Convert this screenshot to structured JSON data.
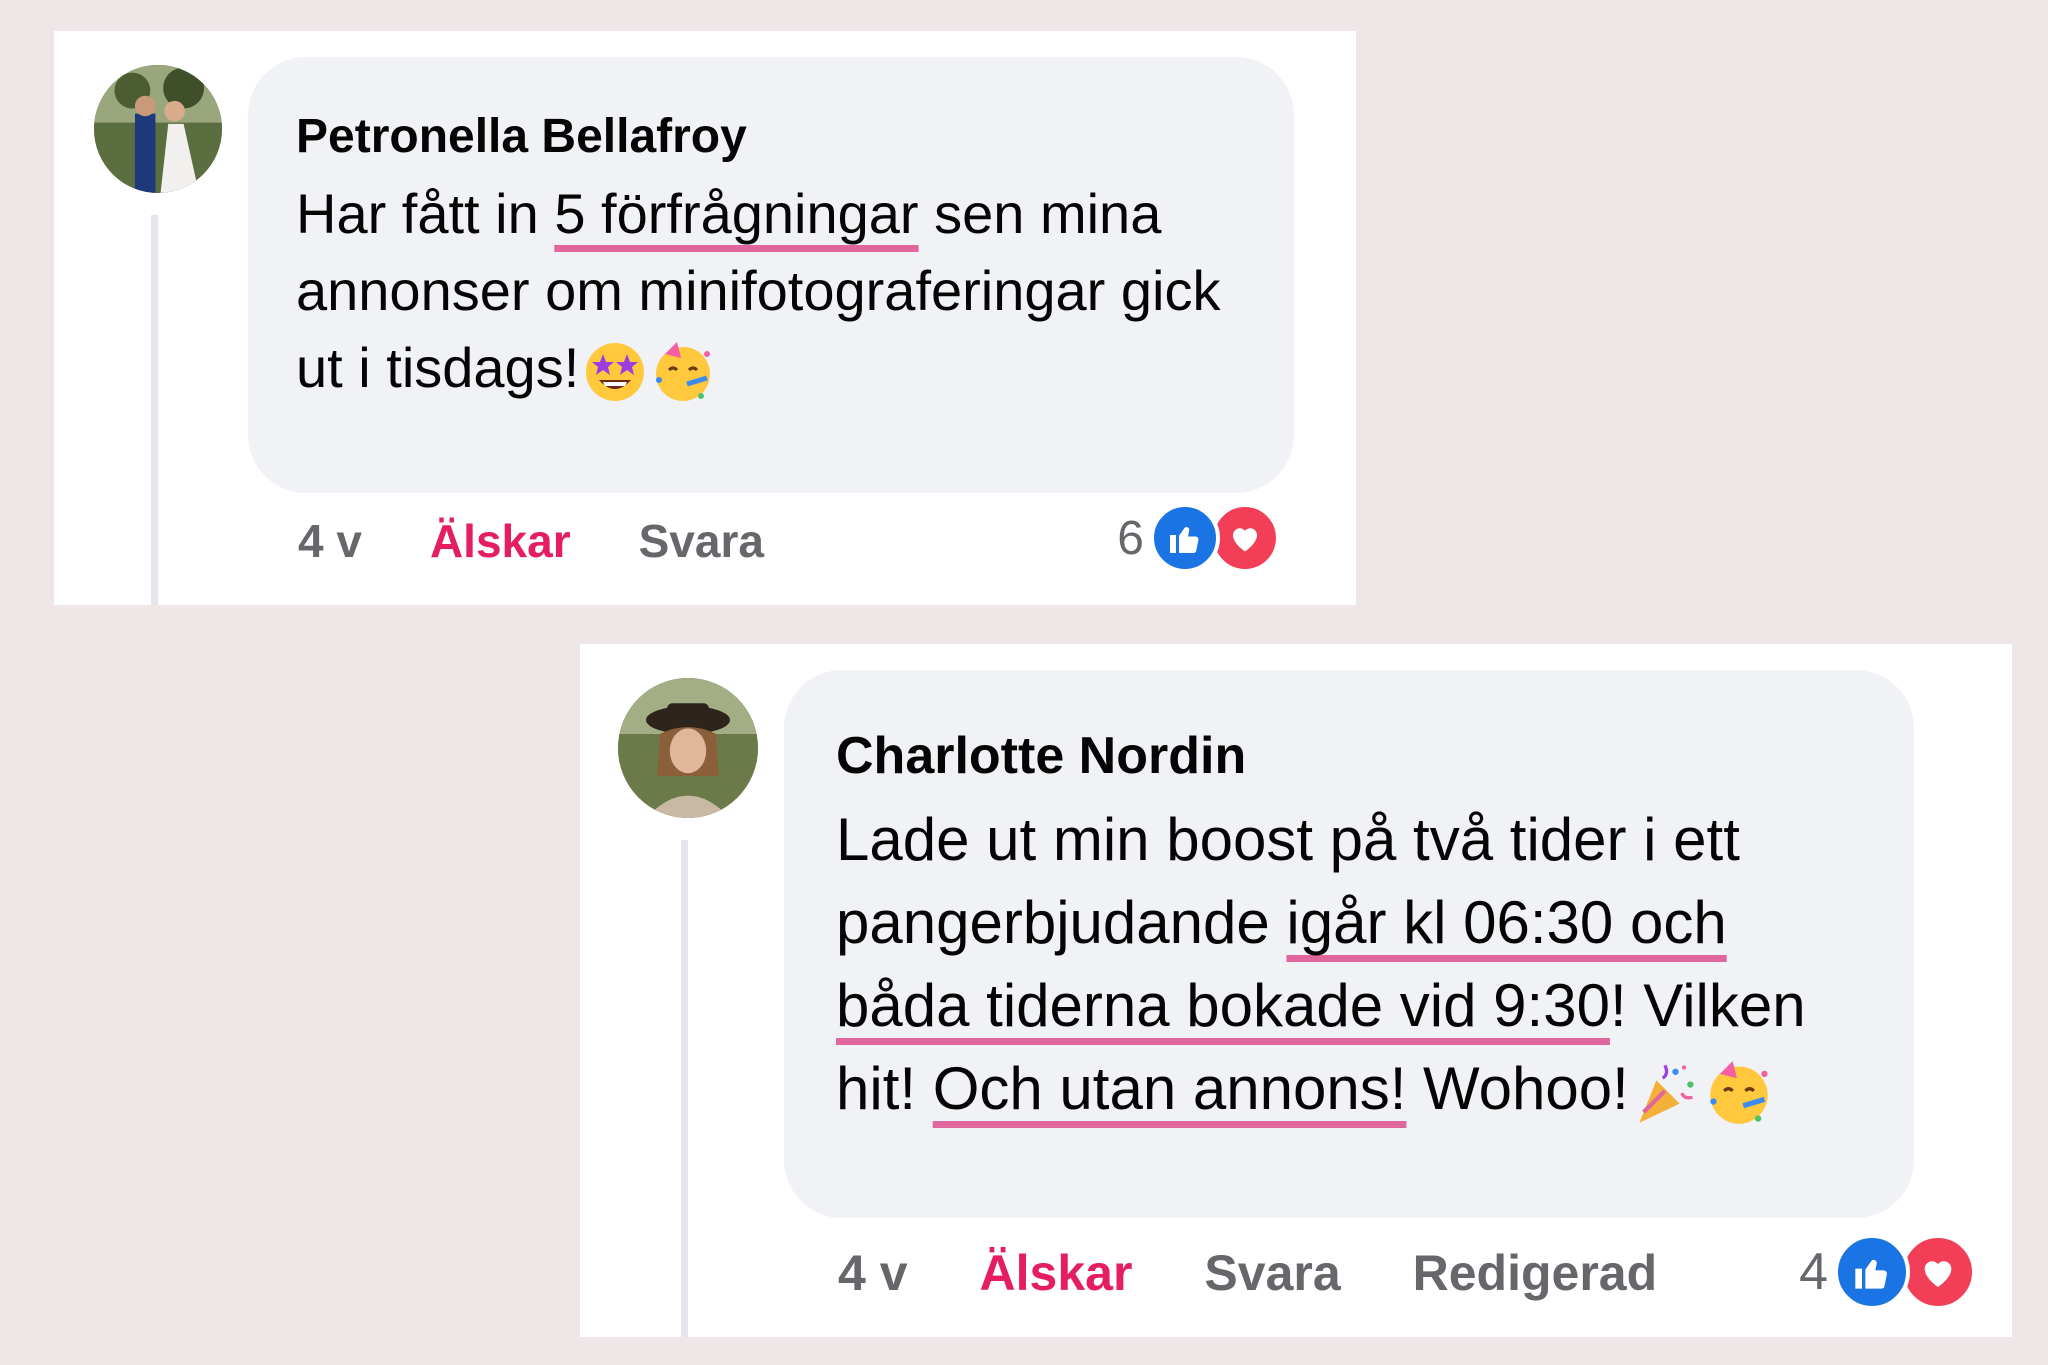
{
  "comments": [
    {
      "author": "Petronella Bellafroy",
      "text_before": "Har fått in ",
      "text_highlight": "5 förfrågningar",
      "text_after": " sen mina annonser om minifotograferingar gick ut i tisdags!",
      "emojis": [
        "star-struck-emoji",
        "partying-face-emoji"
      ],
      "time": "4 v",
      "reaction_label": "Älskar",
      "reply_label": "Svara",
      "reaction_count": "6"
    },
    {
      "author": "Charlotte Nordin",
      "text_before": "Lade ut min boost på två tider i ett pangerbjudande ",
      "text_highlight": "igår kl 06:30 och båda tiderna bokade vid 9:30",
      "text_middle": "! Vilken hit! ",
      "text_highlight2": "Och utan annons!",
      "text_after": " Wohoo!",
      "emojis": [
        "party-popper-emoji",
        "partying-face-emoji"
      ],
      "time": "4 v",
      "reaction_label": "Älskar",
      "reply_label": "Svara",
      "edited_label": "Redigerad",
      "reaction_count": "4"
    }
  ],
  "colors": {
    "background": "#efe6e8",
    "bubble": "#f0f2f5",
    "highlight": "#e0679e",
    "love": "#e41e5f",
    "like": "#1b74e4",
    "heart": "#f33e58"
  }
}
